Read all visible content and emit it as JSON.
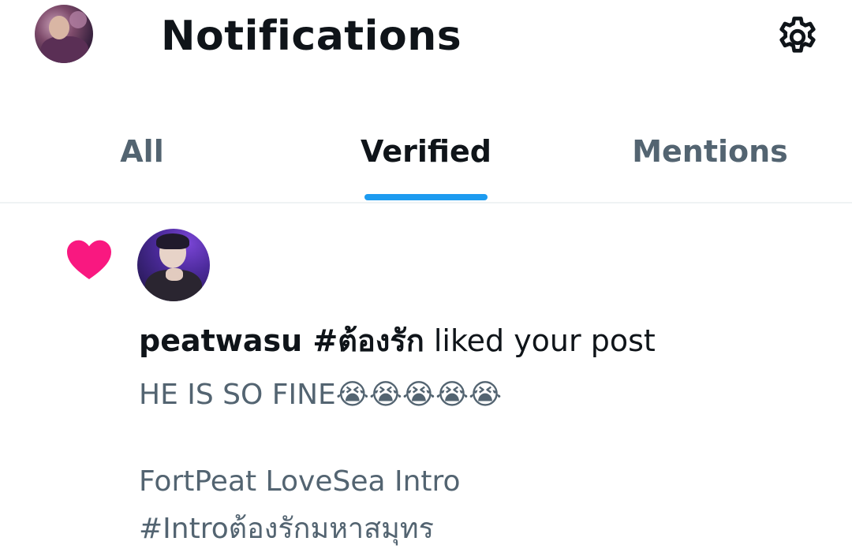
{
  "header": {
    "title": "Notifications",
    "avatar_icon": "profile-avatar-icon",
    "settings_icon": "gear-icon"
  },
  "tabs": [
    {
      "label": "All",
      "active": false
    },
    {
      "label": "Verified",
      "active": true
    },
    {
      "label": "Mentions",
      "active": false
    }
  ],
  "colors": {
    "accent": "#1d9bf0",
    "like": "#f91880",
    "text_primary": "#0f1419",
    "text_secondary": "#536471"
  },
  "notification": {
    "type_icon": "heart-icon",
    "username": "peatwasu #ต้องรัก",
    "action": "liked your post",
    "post_lines": [
      "HE IS SO FINE😭😭😭😭😭",
      "FortPeat LoveSea Intro",
      "#Introต้องรักมหาสมุทร"
    ]
  }
}
